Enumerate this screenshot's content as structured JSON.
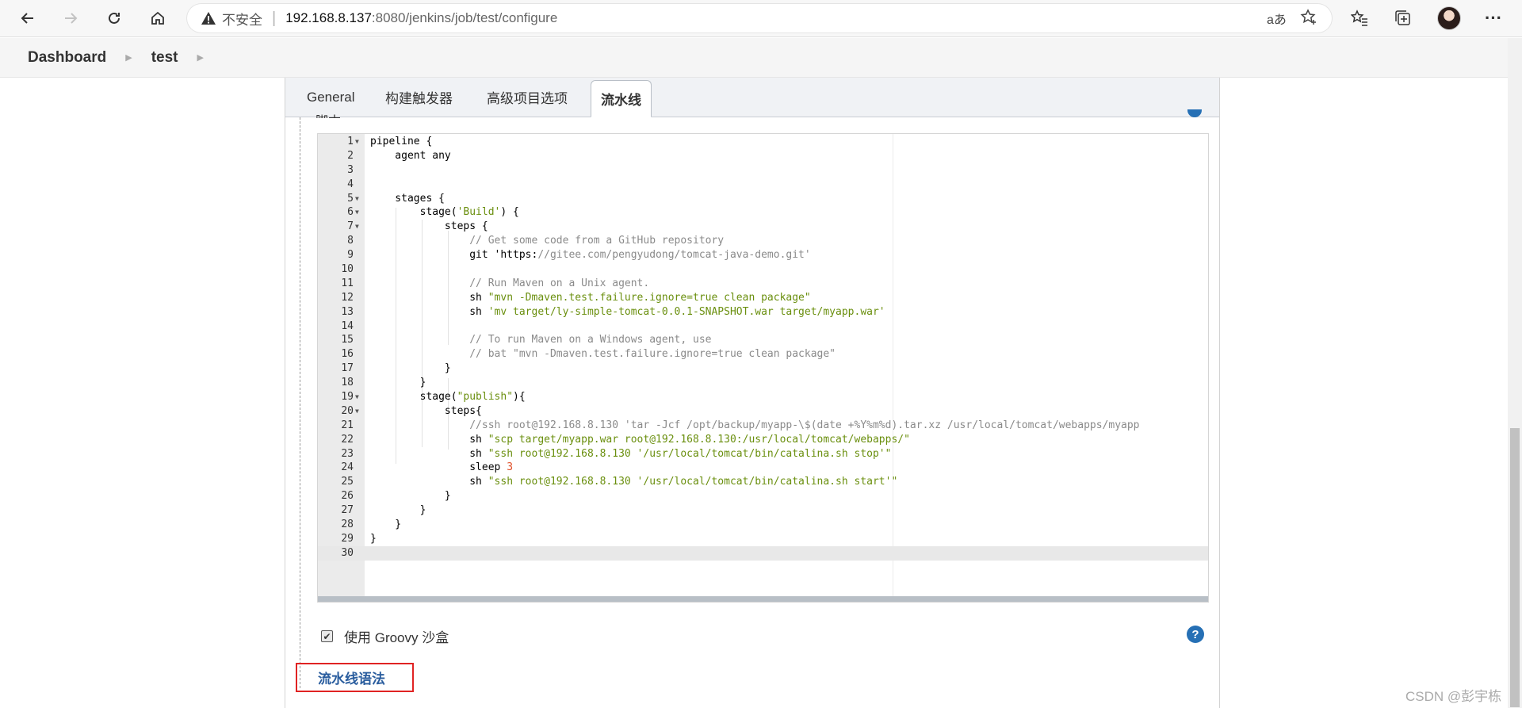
{
  "browser": {
    "insecure_label": "不安全",
    "url_host": "192.168.8.137",
    "url_rest": ":8080/jenkins/job/test/configure",
    "read_aloud_label": "aあ"
  },
  "breadcrumb": [
    "Dashboard",
    "test"
  ],
  "tabs": [
    {
      "label": "General",
      "active": false
    },
    {
      "label": "构建触发器",
      "active": false
    },
    {
      "label": "高级项目选项",
      "active": false
    },
    {
      "label": "流水线",
      "active": true
    }
  ],
  "section_label": "脚本",
  "editor": {
    "lines": [
      {
        "n": "1",
        "fold": true,
        "text": "pipeline {"
      },
      {
        "n": "2",
        "fold": false,
        "text": "    agent any"
      },
      {
        "n": "3",
        "fold": false,
        "text": ""
      },
      {
        "n": "4",
        "fold": false,
        "text": ""
      },
      {
        "n": "5",
        "fold": true,
        "text": "    stages {"
      },
      {
        "n": "6",
        "fold": true,
        "text": "        stage('Build') {"
      },
      {
        "n": "7",
        "fold": true,
        "text": "            steps {"
      },
      {
        "n": "8",
        "fold": false,
        "text": "                // Get some code from a GitHub repository"
      },
      {
        "n": "9",
        "fold": false,
        "text": "                git 'https://gitee.com/pengyudong/tomcat-java-demo.git'"
      },
      {
        "n": "10",
        "fold": false,
        "text": ""
      },
      {
        "n": "11",
        "fold": false,
        "text": "                // Run Maven on a Unix agent."
      },
      {
        "n": "12",
        "fold": false,
        "text": "                sh \"mvn -Dmaven.test.failure.ignore=true clean package\""
      },
      {
        "n": "13",
        "fold": false,
        "text": "                sh 'mv target/ly-simple-tomcat-0.0.1-SNAPSHOT.war target/myapp.war'"
      },
      {
        "n": "14",
        "fold": false,
        "text": ""
      },
      {
        "n": "15",
        "fold": false,
        "text": "                // To run Maven on a Windows agent, use"
      },
      {
        "n": "16",
        "fold": false,
        "text": "                // bat \"mvn -Dmaven.test.failure.ignore=true clean package\""
      },
      {
        "n": "17",
        "fold": false,
        "text": "            }"
      },
      {
        "n": "18",
        "fold": false,
        "text": "        }"
      },
      {
        "n": "19",
        "fold": true,
        "text": "        stage(\"publish\"){"
      },
      {
        "n": "20",
        "fold": true,
        "text": "            steps{"
      },
      {
        "n": "21",
        "fold": false,
        "text": "                //ssh root@192.168.8.130 'tar -Jcf /opt/backup/myapp-\\$(date +%Y%m%d).tar.xz /usr/local/tomcat/webapps/myapp"
      },
      {
        "n": "22",
        "fold": false,
        "text": "                sh \"scp target/myapp.war root@192.168.8.130:/usr/local/tomcat/webapps/\""
      },
      {
        "n": "23",
        "fold": false,
        "text": "                sh \"ssh root@192.168.8.130 '/usr/local/tomcat/bin/catalina.sh stop'\""
      },
      {
        "n": "24",
        "fold": false,
        "text": "                sleep 3"
      },
      {
        "n": "25",
        "fold": false,
        "text": "                sh \"ssh root@192.168.8.130 '/usr/local/tomcat/bin/catalina.sh start'\""
      },
      {
        "n": "26",
        "fold": false,
        "text": "            }"
      },
      {
        "n": "27",
        "fold": false,
        "text": "        }"
      },
      {
        "n": "28",
        "fold": false,
        "text": "    }"
      },
      {
        "n": "29",
        "fold": false,
        "text": "}"
      },
      {
        "n": "30",
        "fold": false,
        "text": ""
      }
    ],
    "active_line": "30"
  },
  "sandbox": {
    "label": "使用 Groovy 沙盒",
    "checked": true
  },
  "help_icon_label": "?",
  "pipeline_syntax_link": "流水线语法",
  "watermark": "CSDN @彭宇栋",
  "colors": {
    "link": "#2a5d9e",
    "highlight_border": "#e02323",
    "help": "#2670b5"
  }
}
